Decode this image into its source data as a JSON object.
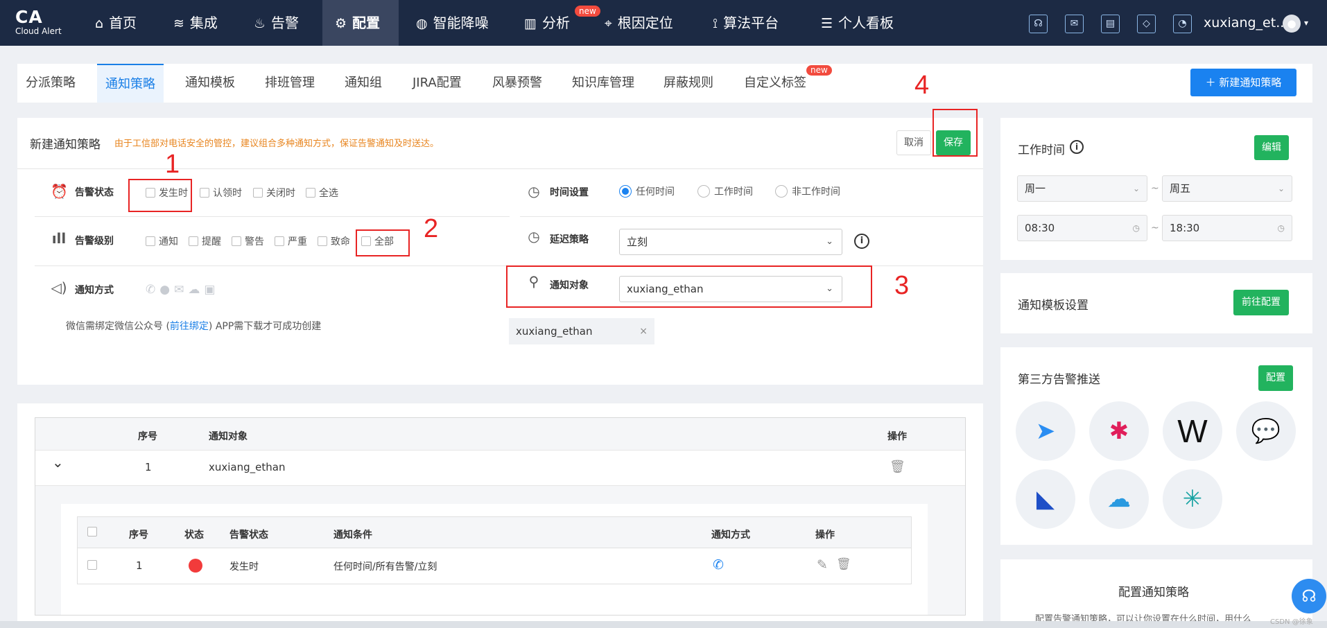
{
  "app": {
    "logo": "CA",
    "logo_sub": "Cloud Alert"
  },
  "nav": {
    "items": [
      {
        "label": "首页",
        "icon": "home-icon"
      },
      {
        "label": "集成",
        "icon": "layers-icon"
      },
      {
        "label": "告警",
        "icon": "siren-icon"
      },
      {
        "label": "配置",
        "icon": "gear-icon"
      },
      {
        "label": "智能降噪",
        "icon": "noise-icon"
      },
      {
        "label": "分析",
        "icon": "bar-chart-icon"
      },
      {
        "label": "根因定位",
        "icon": "target-icon"
      },
      {
        "label": "算法平台",
        "icon": "algorithm-icon"
      },
      {
        "label": "个人看板",
        "icon": "dashboard-icon"
      }
    ],
    "new_badge": "new",
    "username": "xuxiang_et...",
    "caret": "▾"
  },
  "tabs": {
    "items": [
      "分派策略",
      "通知策略",
      "通知模板",
      "排班管理",
      "通知组",
      "JIRA配置",
      "风暴预警",
      "知识库管理",
      "屏蔽规则",
      "自定义标签"
    ],
    "new_badge": "new",
    "new_button": "＋  新建通知策略"
  },
  "form": {
    "title": "新建通知策略",
    "warning": "由于工信部对电话安全的管控，建议组合多种通知方式，保证告警通知及时送达。",
    "cancel": "取消",
    "save": "保存",
    "alert_state": {
      "label": "告警状态",
      "options": [
        "发生时",
        "认领时",
        "关闭时",
        "全选"
      ]
    },
    "alert_level": {
      "label": "告警级别",
      "options": [
        "通知",
        "提醒",
        "警告",
        "严重",
        "致命",
        "全部"
      ]
    },
    "notify_method": {
      "label": "通知方式",
      "icons": [
        "phone-icon",
        "chat-icon",
        "mail-icon",
        "wechat-icon",
        "app-icon"
      ]
    },
    "note_pre": "微信需绑定微信公众号 (",
    "note_link": "前往绑定",
    "note_post": ") APP需下载才可成功创建",
    "time_setting": {
      "label": "时间设置",
      "options": [
        "任何时间",
        "工作时间",
        "非工作时间"
      ],
      "selected": "任何时间"
    },
    "delay": {
      "label": "延迟策略",
      "value": "立刻"
    },
    "target": {
      "label": "通知对象",
      "value": "xuxiang_ethan"
    },
    "tag": "xuxiang_ethan",
    "tag_close": "×"
  },
  "annotations": [
    "1",
    "2",
    "3",
    "4"
  ],
  "table": {
    "headers": [
      "序号",
      "通知对象",
      "操作"
    ],
    "row": {
      "index": "1",
      "target": "xuxiang_ethan"
    },
    "expand_icon": "⌄",
    "sub_headers": [
      "序号",
      "状态",
      "告警状态",
      "通知条件",
      "通知方式",
      "操作"
    ],
    "sub_row": {
      "index": "1",
      "state": "发生时",
      "condition": "任何时间/所有告警/立刻"
    }
  },
  "right": {
    "worktime": {
      "title": "工作时间",
      "edit": "编辑",
      "day_from": "周一",
      "day_to": "周五",
      "time_from": "08:30",
      "time_to": "18:30",
      "tilde": "~"
    },
    "template": {
      "title": "通知模板设置",
      "button": "前往配置"
    },
    "third_party": {
      "title": "第三方告警推送",
      "button": "配置"
    },
    "config": {
      "title": "配置通知策略",
      "desc": "配置告警通知策略，可以让你设置在什么时间，用什么"
    }
  },
  "watermark": "CSDN @徐象",
  "colors": {
    "nav_bg": "#1c2a44",
    "primary": "#1a82f0",
    "green": "#22b35e",
    "red": "#e82424",
    "warning": "#e8851f"
  }
}
